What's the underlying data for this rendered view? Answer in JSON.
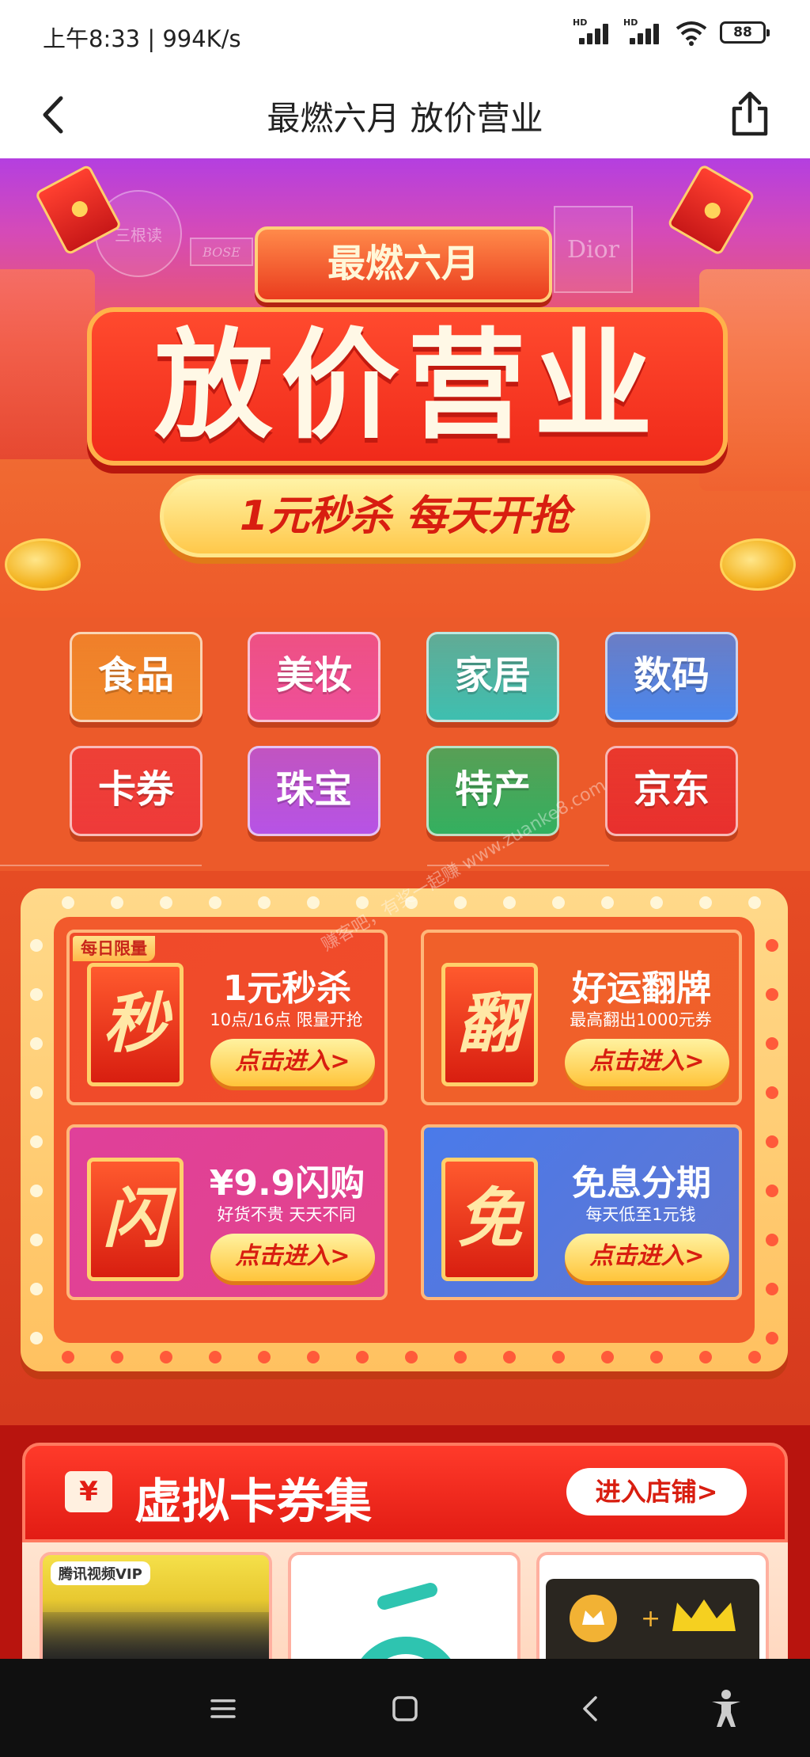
{
  "status_bar": {
    "time": "上午8:33 | 994K/s",
    "battery": "88",
    "hd": "HD"
  },
  "header": {
    "title": "最燃六月 放价营业"
  },
  "hero": {
    "badge": "最燃六月",
    "main_title": "放价营业",
    "slogan": "1元秒杀 每天开抢",
    "shop_signs": [
      "三根读",
      "BOSE",
      "Dior"
    ]
  },
  "categories": [
    {
      "label": "食品",
      "color": "#f0892a"
    },
    {
      "label": "美妆",
      "color": "#ee4f9a"
    },
    {
      "label": "家居",
      "color": "#3ebfb0"
    },
    {
      "label": "数码",
      "color": "#4a86ec"
    },
    {
      "label": "卡券",
      "color": "#ee3a3a"
    },
    {
      "label": "珠宝",
      "color": "#b653e6"
    },
    {
      "label": "特产",
      "color": "#33b060"
    },
    {
      "label": "京东",
      "color": "#e8302e"
    }
  ],
  "watermark": "赚客吧，有奖一起赚 www.zuanke8.com",
  "promo": {
    "daily_tag": "每日限量",
    "cards": [
      {
        "icon": "秒",
        "title": "1元秒杀",
        "subtitle": "10点/16点 限量开抢",
        "button": "点击进入>",
        "bg": "#f04a2a"
      },
      {
        "icon": "翻",
        "title": "好运翻牌",
        "subtitle": "最高翻出1000元券",
        "button": "点击进入>",
        "bg": "#f0602a"
      },
      {
        "icon": "闪",
        "title": "¥9.9闪购",
        "subtitle": "好货不贵 天天不同",
        "button": "点击进入>",
        "bg": "#e0409a"
      },
      {
        "icon": "免",
        "title": "免息分期",
        "subtitle": "每天低至1元钱",
        "button": "点击进入>",
        "bg": "#4a7aea"
      }
    ]
  },
  "voucher": {
    "title": "虚拟卡券集",
    "icon": "¥",
    "shop_button": "进入店铺>",
    "items": [
      {
        "label": "腾讯视频VIP"
      },
      {
        "label": ""
      },
      {
        "label": ""
      }
    ]
  },
  "nav": {
    "items": [
      "menu",
      "home",
      "back",
      "accessibility"
    ]
  }
}
